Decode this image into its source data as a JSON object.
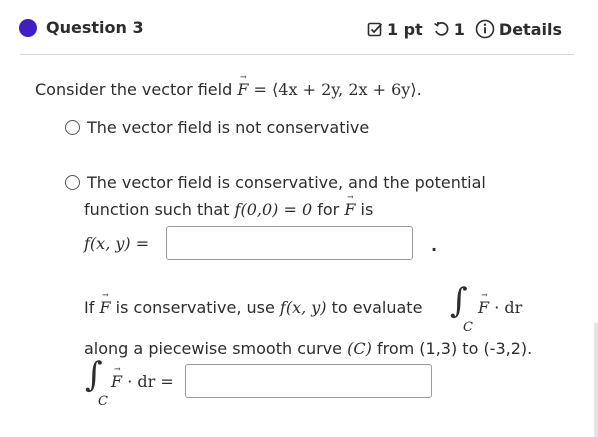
{
  "header": {
    "question_title": "Question 3",
    "points": "1 pt",
    "retries": "1",
    "details": "Details",
    "accent_color": "#3f1fc4"
  },
  "prompt": {
    "text": "Consider the vector field",
    "field_formula": "= ⟨4x + 2y, 2x + 6y⟩."
  },
  "options": {
    "not_conservative": "The vector field is not conservative",
    "conservative_line1": "The vector field is conservative, and the potential",
    "conservative_line2": "function such that",
    "conservative_condition": "f(0,0) = 0",
    "conservative_for": "for",
    "conservative_is": "is",
    "f_label": "f(x, y) =",
    "f_value": "",
    "period": "."
  },
  "part2": {
    "if_text": "If",
    "is_conservative_use": "is conservative, use",
    "fxy": "f(x, y)",
    "to_evaluate": "to evaluate",
    "integrand": "· dr",
    "along_text": "along a piecewise smooth curve",
    "curve": "(C)",
    "from_to": "from (1,3) to (-3,2).",
    "answer_label_integrand": "· dr =",
    "answer_value": "",
    "subscript": "C"
  },
  "icons": {
    "points": "checkbox-edit-icon",
    "retries": "retry-icon",
    "details": "info-icon"
  }
}
